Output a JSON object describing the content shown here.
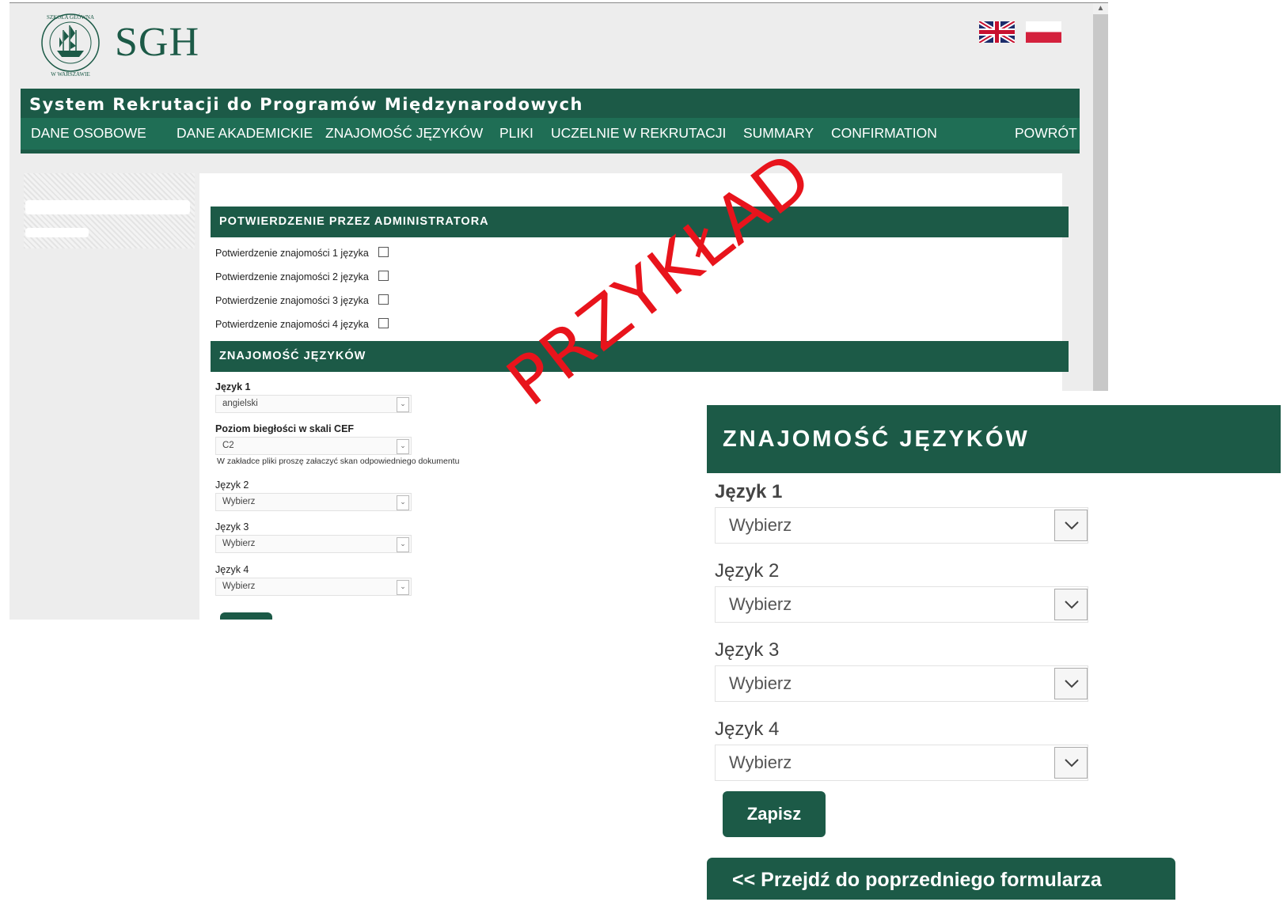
{
  "brand": {
    "logo_text": "SGH"
  },
  "system_title": "System Rekrutacji do Programów Międzynarodowych",
  "nav": {
    "items": [
      "DANE OSOBOWE",
      "DANE AKADEMICKIE",
      "ZNAJOMOŚĆ JĘZYKÓW",
      "PLIKI",
      "UCZELNIE W REKRUTACJI",
      "SUMMARY",
      "CONFIRMATION"
    ],
    "back": "POWRÓT"
  },
  "admin_section": {
    "title": "POTWIERDZENIE PRZEZ ADMINISTRATORA",
    "confirmations": [
      "Potwierdzenie znajomości 1 języka",
      "Potwierdzenie znajomości 2 języka",
      "Potwierdzenie znajomości 3 języka",
      "Potwierdzenie znajomości 4 języka"
    ]
  },
  "languages_section": {
    "title": "ZNAJOMOŚĆ JĘZYKÓW",
    "lang1_label": "Język 1",
    "lang1_value": "angielski",
    "level_label": "Poziom biegłości w skali CEF",
    "level_value": "C2",
    "note": "W zakładce pliki proszę załaczyć skan odpowiedniego dokumentu",
    "lang2_label": "Język 2",
    "lang2_value": "Wybierz",
    "lang3_label": "Język 3",
    "lang3_value": "Wybierz",
    "lang4_label": "Język 4",
    "lang4_value": "Wybierz"
  },
  "watermark": "PRZYKŁAD",
  "zoom": {
    "title": "ZNAJOMOŚĆ JĘZYKÓW",
    "fields": [
      {
        "label": "Język 1",
        "value": "Wybierz"
      },
      {
        "label": "Język 2",
        "value": "Wybierz"
      },
      {
        "label": "Język 3",
        "value": "Wybierz"
      },
      {
        "label": "Język 4",
        "value": "Wybierz"
      }
    ],
    "save_label": "Zapisz",
    "prev_label": "<< Przejdź do poprzedniego formularza"
  },
  "colors": {
    "brand_green": "#1c5a47",
    "nav_green": "#1f6e55",
    "watermark_red": "#e8141c"
  }
}
